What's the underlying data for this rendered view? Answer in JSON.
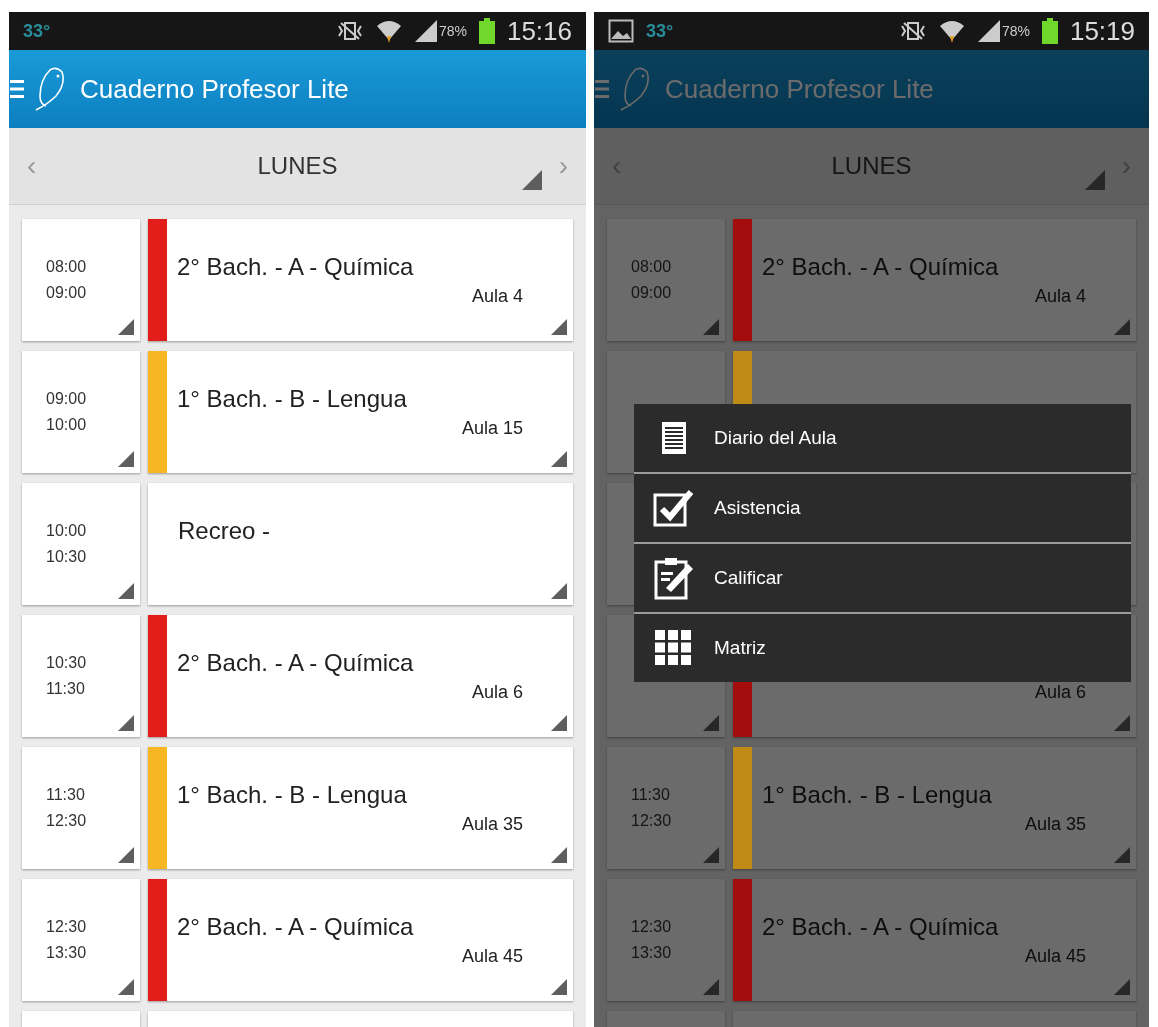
{
  "screens": [
    {
      "status_bar": {
        "temperature": "33°",
        "battery_text": "78%",
        "time": "15:16",
        "gallery_notice": false
      },
      "app_bar": {
        "title": "Cuaderno Profesor Lite"
      },
      "day_bar": {
        "prev": "‹",
        "day": "LUNES",
        "next": "›"
      },
      "dimmed": false,
      "slots": [
        {
          "start": "08:00",
          "end": "09:00",
          "title": "2° Bach.  - A - Química",
          "room": "Aula 4",
          "color": "#e31d1a"
        },
        {
          "start": "09:00",
          "end": "10:00",
          "title": "1° Bach.  - B - Lengua",
          "room": "Aula 15",
          "color": "#f6b722"
        },
        {
          "kind": "break",
          "start": "10:00",
          "end": "10:30",
          "title": "Recreo -"
        },
        {
          "start": "10:30",
          "end": "11:30",
          "title": "2° Bach.  - A - Química",
          "room": "Aula 6",
          "color": "#e31d1a"
        },
        {
          "start": "11:30",
          "end": "12:30",
          "title": "1° Bach.  - B - Lengua",
          "room": "Aula 35",
          "color": "#f6b722"
        },
        {
          "start": "12:30",
          "end": "13:30",
          "title": "2° Bach.  - A - Química",
          "room": "Aula 45",
          "color": "#e31d1a"
        }
      ]
    },
    {
      "status_bar": {
        "temperature": "33°",
        "battery_text": "78%",
        "time": "15:19",
        "gallery_notice": true
      },
      "app_bar": {
        "title": "Cuaderno Profesor Lite"
      },
      "day_bar": {
        "prev": "‹",
        "day": "LUNES",
        "next": "›"
      },
      "dimmed": true,
      "slots": [
        {
          "start": "08:00",
          "end": "09:00",
          "title": "2° Bach.  - A - Química",
          "room": "Aula 4",
          "color": "#a30d0d"
        },
        {
          "color": "#c08a17"
        },
        {
          "kind": "break"
        },
        {
          "room": "Aula 6",
          "color": "#a30d0d"
        },
        {
          "start": "11:30",
          "end": "12:30",
          "title": "1° Bach.  - B - Lengua",
          "room": "Aula 35",
          "color": "#c08a17"
        },
        {
          "start": "12:30",
          "end": "13:30",
          "title": "2° Bach.  - A - Química",
          "room": "Aula 45",
          "color": "#a30d0d"
        }
      ],
      "menu": {
        "items": [
          {
            "kind": "journal",
            "label": "Diario del Aula"
          },
          {
            "kind": "attendance",
            "label": "Asistencia"
          },
          {
            "kind": "grade",
            "label": "Calificar"
          },
          {
            "kind": "matrix",
            "label": "Matriz"
          }
        ]
      }
    }
  ]
}
